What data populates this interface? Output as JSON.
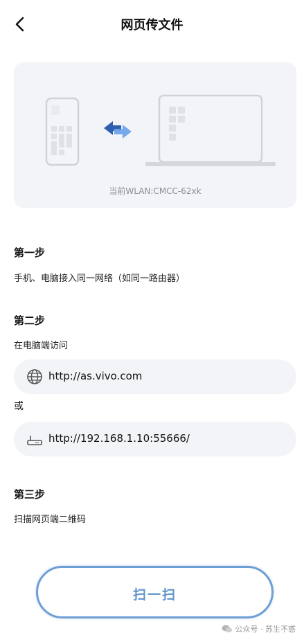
{
  "header": {
    "title": "网页传文件"
  },
  "illustration": {
    "wlan_text": "当前WLAN:CMCC-62xk"
  },
  "steps": [
    {
      "title": "第一步",
      "desc": "手机、电脑接入同一网络（如同一路由器）"
    },
    {
      "title": "第二步",
      "desc": "在电脑端访问"
    },
    {
      "title": "第三步",
      "desc": "扫描网页端二维码"
    }
  ],
  "urls": {
    "primary": "http://as.vivo.com",
    "or_label": "或",
    "secondary": "http://192.168.1.10:55666/"
  },
  "scan_button": {
    "label": "扫一扫"
  },
  "watermark": {
    "text": "公众号 · 苏生不惑"
  },
  "colors": {
    "accent": "#6d9fd4",
    "card_bg": "#f3f4f7",
    "text": "#111111",
    "muted": "#8a8d93"
  },
  "icons": {
    "back": "chevron-left-icon",
    "globe": "globe-icon",
    "router": "router-icon"
  }
}
